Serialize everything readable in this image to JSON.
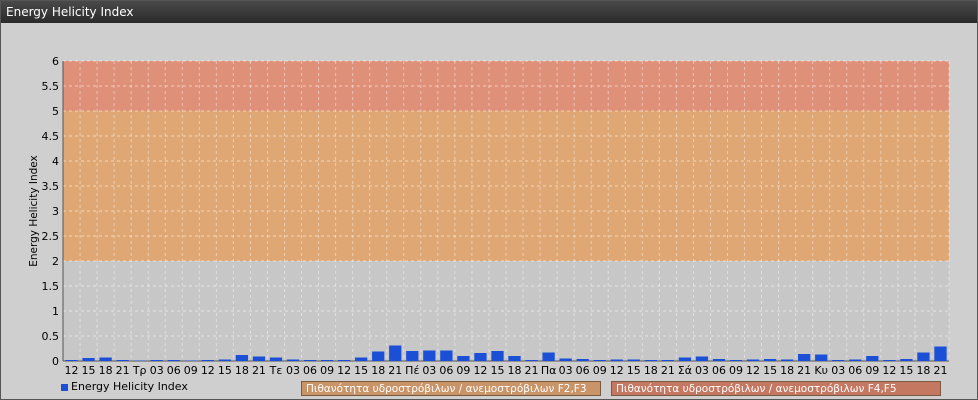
{
  "window": {
    "title": "Energy Helicity Index"
  },
  "chart_data": {
    "type": "bar",
    "title": "",
    "ylabel": "Energy Helicity Index",
    "ylim": [
      0,
      6
    ],
    "yticks": [
      "0",
      "0.5",
      "1",
      "1.5",
      "2",
      "2.5",
      "3",
      "3.5",
      "4",
      "4.5",
      "5",
      "5.5",
      "6"
    ],
    "grid": true,
    "categories": [
      "12",
      "15",
      "18",
      "21",
      "Τρ",
      "03",
      "06",
      "09",
      "12",
      "15",
      "18",
      "21",
      "Τε",
      "03",
      "06",
      "09",
      "12",
      "15",
      "18",
      "21",
      "Πέ",
      "03",
      "06",
      "09",
      "12",
      "15",
      "18",
      "21",
      "Πα",
      "03",
      "06",
      "09",
      "12",
      "15",
      "18",
      "21",
      "Σά",
      "03",
      "06",
      "09",
      "12",
      "15",
      "18",
      "21",
      "Κυ",
      "03",
      "06",
      "09",
      "12",
      "15",
      "18",
      "21"
    ],
    "series": [
      {
        "name": "Energy Helicity Index",
        "color": "#1a4fd6",
        "values": [
          0.02,
          0.06,
          0.07,
          0.02,
          0.01,
          0.02,
          0.02,
          0.01,
          0.02,
          0.03,
          0.12,
          0.09,
          0.07,
          0.03,
          0.02,
          0.02,
          0.02,
          0.07,
          0.19,
          0.31,
          0.2,
          0.21,
          0.21,
          0.1,
          0.16,
          0.2,
          0.1,
          0.02,
          0.17,
          0.05,
          0.04,
          0.02,
          0.03,
          0.03,
          0.02,
          0.02,
          0.07,
          0.09,
          0.04,
          0.02,
          0.03,
          0.04,
          0.03,
          0.14,
          0.13,
          0.02,
          0.03,
          0.1,
          0.02,
          0.04,
          0.17,
          0.29
        ]
      }
    ],
    "bands": [
      {
        "from": 2,
        "to": 5,
        "label": "Πιθανότητα υδροστρόβιλων / ανεμοστρόβιλων F2,F3",
        "color": "#e0a36a"
      },
      {
        "from": 5,
        "to": 6,
        "label": "Πιθανότητα υδροστρόβιλων / ανεμοστρόβιλων F4,F5",
        "color": "#e08a70"
      }
    ],
    "legend": "bottom-left"
  }
}
